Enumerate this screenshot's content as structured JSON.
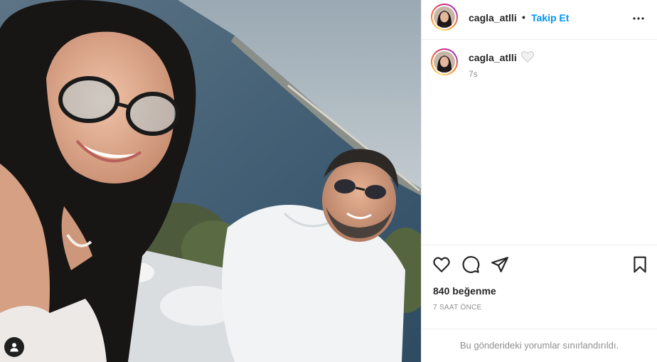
{
  "post": {
    "username": "cagla_atlli",
    "follow_label": "Takip Et",
    "separator": "•",
    "caption": {
      "username": "cagla_atlli",
      "emoji": "white-heart",
      "age": "7s"
    },
    "likes": "840 beğenme",
    "timestamp": "7 SAAT ÖNCE",
    "comments_notice": "Bu gönderideki yorumlar sınırlandırıldı."
  },
  "icons": {
    "more": "more-horizontal-icon",
    "like": "heart-outline-icon",
    "comment": "comment-bubble-icon",
    "share": "paper-plane-icon",
    "save": "bookmark-icon",
    "tags": "user-tag-icon"
  },
  "colors": {
    "accent": "#0095f6",
    "text": "#262626",
    "muted": "#8e8e8e",
    "border": "#efefef"
  }
}
